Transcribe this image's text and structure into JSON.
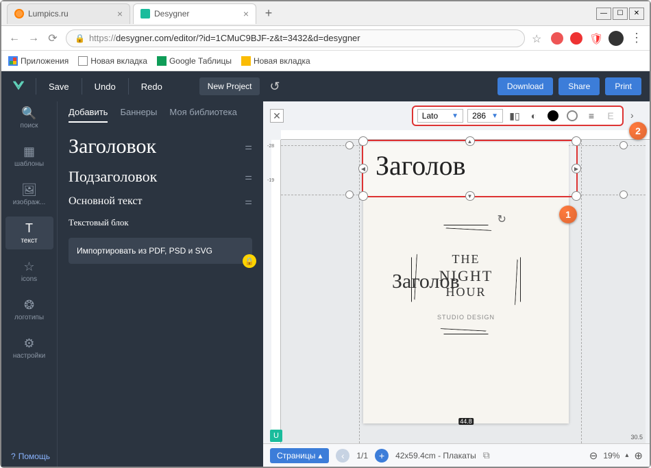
{
  "browser": {
    "tabs": [
      {
        "title": "Lumpics.ru",
        "active": false
      },
      {
        "title": "Desygner",
        "active": true
      }
    ],
    "url_prefix": "https://",
    "url": "desygner.com/editor/?id=1CMuC9BJF-z&t=3432&d=desygner",
    "bookmarks": [
      "Приложения",
      "Новая вкладка",
      "Google Таблицы",
      "Новая вкладка"
    ]
  },
  "toolbar": {
    "save": "Save",
    "undo": "Undo",
    "redo": "Redo",
    "new_project": "New Project",
    "download": "Download",
    "share": "Share",
    "print": "Print"
  },
  "sidenav": {
    "items": [
      {
        "label": "поиск"
      },
      {
        "label": "шаблоны"
      },
      {
        "label": "изображ..."
      },
      {
        "label": "текст"
      },
      {
        "label": "icons"
      },
      {
        "label": "логотипы"
      },
      {
        "label": "настройки"
      }
    ]
  },
  "panel": {
    "tabs": [
      "Добавить",
      "Баннеры",
      "Моя библиотека"
    ],
    "heading": "Заголовок",
    "subheading": "Подзаголовок",
    "body": "Основной текст",
    "block": "Текстовый блок",
    "import": "Импортировать из PDF, PSD и SVG"
  },
  "context": {
    "font": "Lato",
    "size": "286"
  },
  "selection": {
    "text": "Заголов",
    "duplicate": "Заголов"
  },
  "poster": {
    "line1": "THE",
    "line2": "NIGHT",
    "line3": "HOUR",
    "studio": "STUDIO DESIGN"
  },
  "rulers": {
    "v1": "-28",
    "v2": "-19",
    "size_label": "44.8",
    "side_label": "30.5"
  },
  "bottom": {
    "pages": "Страницы",
    "page_num": "1/1",
    "dims": "42x59.4cm - Плакаты",
    "zoom": "19%"
  },
  "help": "Помощь",
  "callouts": {
    "one": "1",
    "two": "2"
  }
}
